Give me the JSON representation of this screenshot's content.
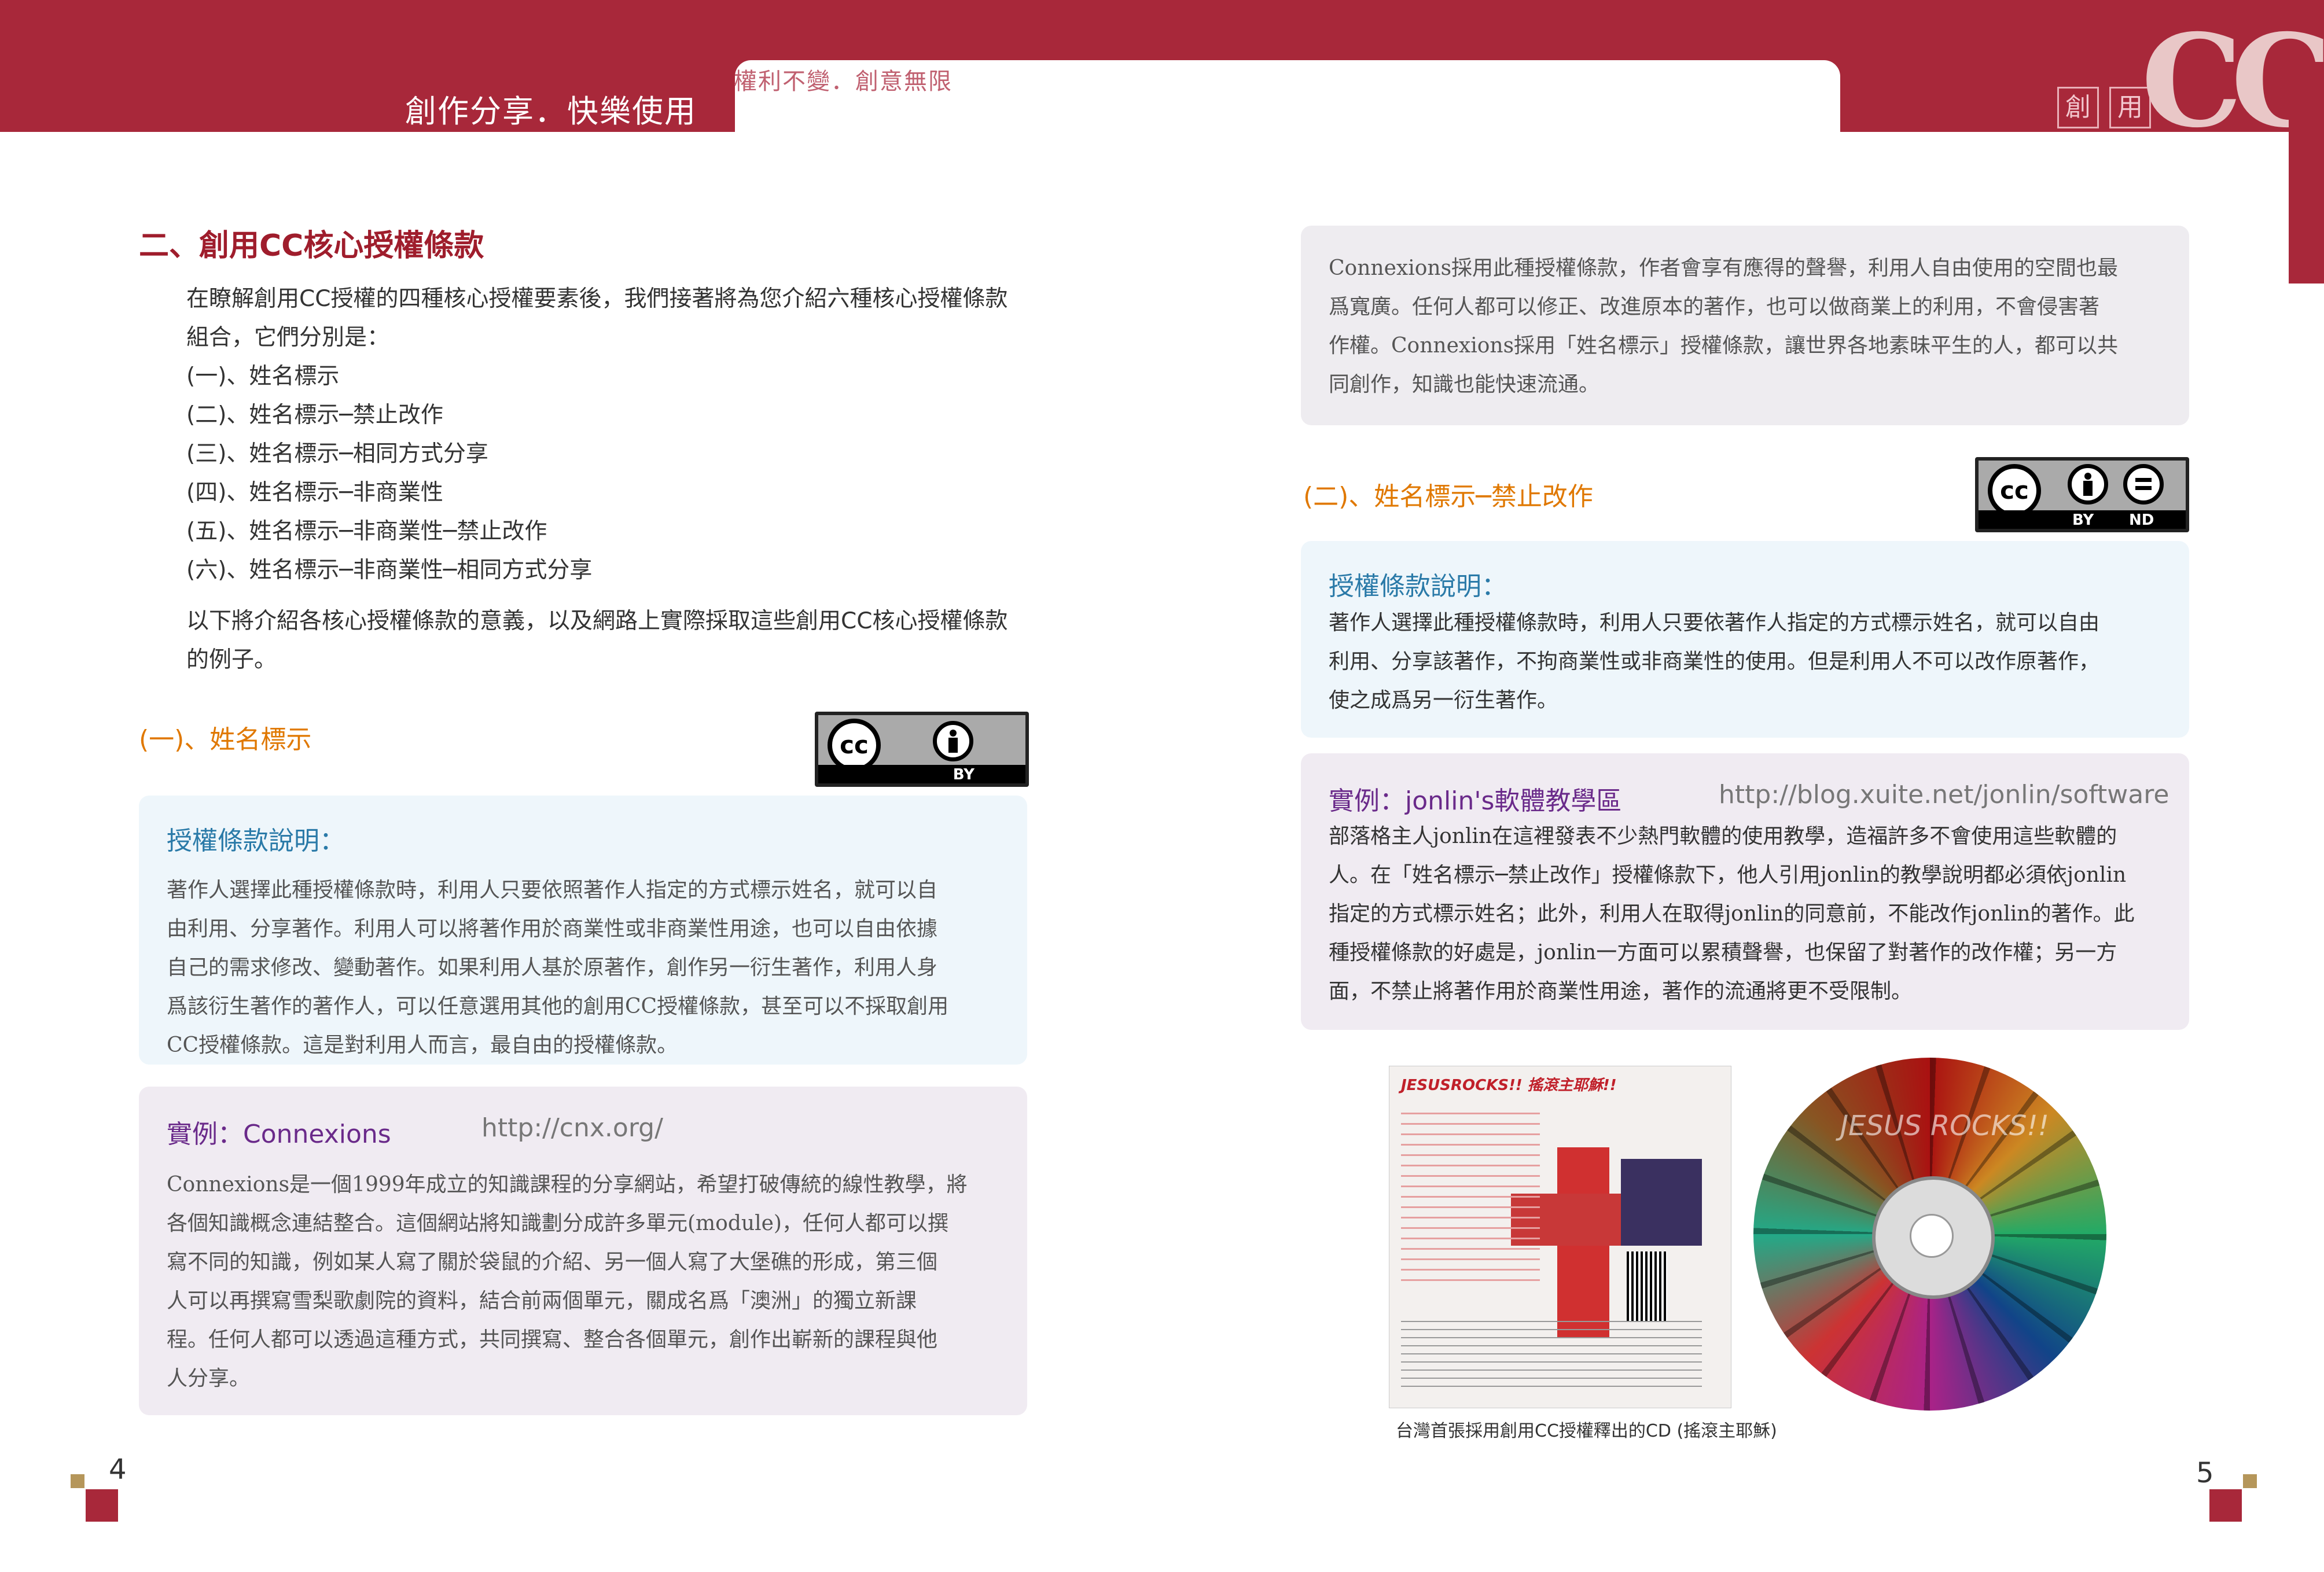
{
  "header": {
    "title": "創作分享．快樂使用",
    "slogan": "權利不變．創意無限",
    "box1": "創",
    "box2": "用",
    "logo": "CC"
  },
  "left": {
    "section_title": "二、創用CC核心授權條款",
    "intro_lines": [
      "在瞭解創用CC授權的四種核心授權要素後，我們接著將為您介紹六種核心授權條款",
      "組合，它們分別是："
    ],
    "list": [
      "(一)、姓名標示",
      "(二)、姓名標示─禁止改作",
      "(三)、姓名標示─相同方式分享",
      "(四)、姓名標示─非商業性",
      "(五)、姓名標示─非商業性─禁止改作",
      "(六)、姓名標示─非商業性─相同方式分享"
    ],
    "outro_lines": [
      "以下將介紹各核心授權條款的意義，以及網路上實際採取這些創用CC核心授權條款",
      "的例子。"
    ],
    "sub_title": "(一)、姓名標示",
    "badge": {
      "cc": "cc",
      "label": "BY"
    },
    "explain_head": "授權條款說明：",
    "explain_lines": [
      "著作人選擇此種授權條款時，利用人只要依照著作人指定的方式標示姓名，就可以自",
      "由利用、分享著作。利用人可以將著作用於商業性或非商業性用途，也可以自由依據",
      "自己的需求修改、變動著作。如果利用人基於原著作，創作另一衍生著作，利用人身",
      "爲該衍生著作的著作人，可以任意選用其他的創用CC授權條款，甚至可以不採取創用",
      "CC授權條款。這是對利用人而言，最自由的授權條款。"
    ],
    "example_head": "實例：Connexions",
    "example_url": "http://cnx.org/",
    "example_lines": [
      "Connexions是一個1999年成立的知識課程的分享網站，希望打破傳統的線性教學，將",
      "各個知識概念連結整合。這個網站將知識劃分成許多單元(module)，任何人都可以撰",
      "寫不同的知識，例如某人寫了關於袋鼠的介紹、另一個人寫了大堡礁的形成，第三個",
      "人可以再撰寫雪梨歌劇院的資料，結合前兩個單元，關成名爲「澳洲」的獨立新課",
      "程。任何人都可以透過這種方式，共同撰寫、整合各個單元，創作出嶄新的課程與他",
      "人分享。"
    ],
    "page_number": "4"
  },
  "right": {
    "top_lines": [
      "Connexions採用此種授權條款，作者會享有應得的聲譽，利用人自由使用的空間也最",
      "爲寬廣。任何人都可以修正、改進原本的著作，也可以做商業上的利用，不會侵害著",
      "作權。Connexions採用「姓名標示」授權條款，讓世界各地素昧平生的人，都可以共",
      "同創作，知識也能快速流通。"
    ],
    "sub_title": "(二)、姓名標示─禁止改作",
    "badge": {
      "cc": "cc",
      "label_by": "BY",
      "label_nd": "ND"
    },
    "explain_head": "授權條款說明：",
    "explain_lines": [
      "著作人選擇此種授權條款時，利用人只要依著作人指定的方式標示姓名，就可以自由",
      "利用、分享該著作，不拘商業性或非商業性的使用。但是利用人不可以改作原著作，",
      "使之成爲另一衍生著作。"
    ],
    "example_head": "實例：jonlin's軟體教學區",
    "example_url": "http://blog.xuite.net/jonlin/software",
    "example_lines": [
      "部落格主人jonlin在這裡發表不少熱門軟體的使用教學，造福許多不會使用這些軟體的",
      "人。在「姓名標示─禁止改作」授權條款下，他人引用jonlin的教學說明都必須依jonlin",
      "指定的方式標示姓名；此外，利用人在取得jonlin的同意前，不能改作jonlin的著作。此",
      "種授權條款的好處是，jonlin一方面可以累積聲譽，也保留了對著作的改作權；另一方",
      "面，不禁止將著作用於商業性用途，著作的流通將更不受限制。"
    ],
    "cd_title": "JESUSROCKS!! 搖滾主耶穌!!",
    "cd_disc_text": "JESUS ROCKS!!",
    "caption": "台灣首張採用創用CC授權釋出的CD (搖滾主耶穌)",
    "page_number": "5"
  },
  "colors": {
    "brand_red": "#a8283a",
    "orange": "#e07800",
    "blue": "#2a7aa8",
    "purple": "#6a2a8a"
  }
}
